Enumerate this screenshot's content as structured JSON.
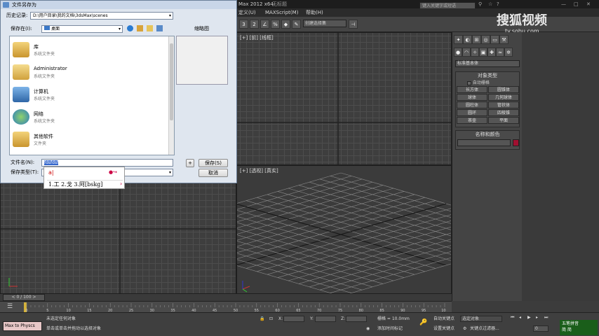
{
  "app": {
    "window_title_fragment": "Max 2012 x64",
    "doc_title": "无标题",
    "menu_items": [
      "定义(U)",
      "MAXScript(M)",
      "帮助(H)"
    ],
    "search_placeholder": "键入关键字或短语",
    "view_selector": "视图",
    "selection_set": "创建选择集",
    "watermark": "搜狐视频",
    "watermark_url": "tv.sohu.com"
  },
  "dialog": {
    "title": "文件另存为",
    "history_label": "历史记录:",
    "history_value": "D:\\用户目录\\我的文档\\3dsMax\\scenes",
    "savein_label": "保存在(I):",
    "savein_value": "桌面",
    "thumbnail_label": "缩略图",
    "files": [
      {
        "name": "库",
        "type": "系统文件夹",
        "icon": "library-icon"
      },
      {
        "name": "Administrator",
        "type": "系统文件夹",
        "icon": "user-folder-icon"
      },
      {
        "name": "计算机",
        "type": "系统文件夹",
        "icon": "computer-icon"
      },
      {
        "name": "网络",
        "type": "系统文件夹",
        "icon": "network-icon"
      },
      {
        "name": "其他软件",
        "type": "文件夹",
        "icon": "folder-icon"
      }
    ],
    "filename_label": "文件名(N):",
    "filename_value": "fdsfdsf",
    "filetype_label": "保存类型(T):",
    "plus_label": "+",
    "save_button": "保存(S)",
    "cancel_button": "取消"
  },
  "ime": {
    "composition": "a|",
    "candidates": "1.工 2.戈 3.阿[bskg]",
    "arrow": "›",
    "nav": "●↪"
  },
  "viewports": {
    "top_left_label": "",
    "front_label": "[+] [前] [线框]",
    "persp_label": "[+] [透视] [真实]"
  },
  "command_panel": {
    "dropdown": "标准基本体",
    "object_type_title": "对象类型",
    "autogrid": "自动栅格",
    "buttons": [
      "长方体",
      "圆锥体",
      "球体",
      "几何球体",
      "圆柱体",
      "管状体",
      "圆环",
      "四棱锥",
      "茶壶",
      "平面"
    ],
    "name_color_title": "名称和颜色",
    "object_color": "#a01030"
  },
  "timeline": {
    "slider": "0 / 100",
    "ticks": [
      "0",
      "5",
      "10",
      "15",
      "20",
      "25",
      "30",
      "35",
      "40",
      "45",
      "50",
      "55",
      "60",
      "65",
      "70",
      "75",
      "80",
      "85",
      "90",
      "95",
      "100"
    ]
  },
  "status": {
    "script_area": "Max to Physcs",
    "line1": "未选定任何对象",
    "line2": "单击或单击并拖动以选择对象",
    "x_label": "X:",
    "y_label": "Y:",
    "z_label": "Z:",
    "grid": "栅格 = 10.0mm",
    "add_time_tag": "添加时间标记",
    "auto_key": "自动关键点",
    "selected_obj": "选定对象",
    "set_key": "设置关键点",
    "key_filter": "关键点过滤器...",
    "frame": "0",
    "ime_status": "五笔拼音",
    "ime_status2": "简 简"
  }
}
